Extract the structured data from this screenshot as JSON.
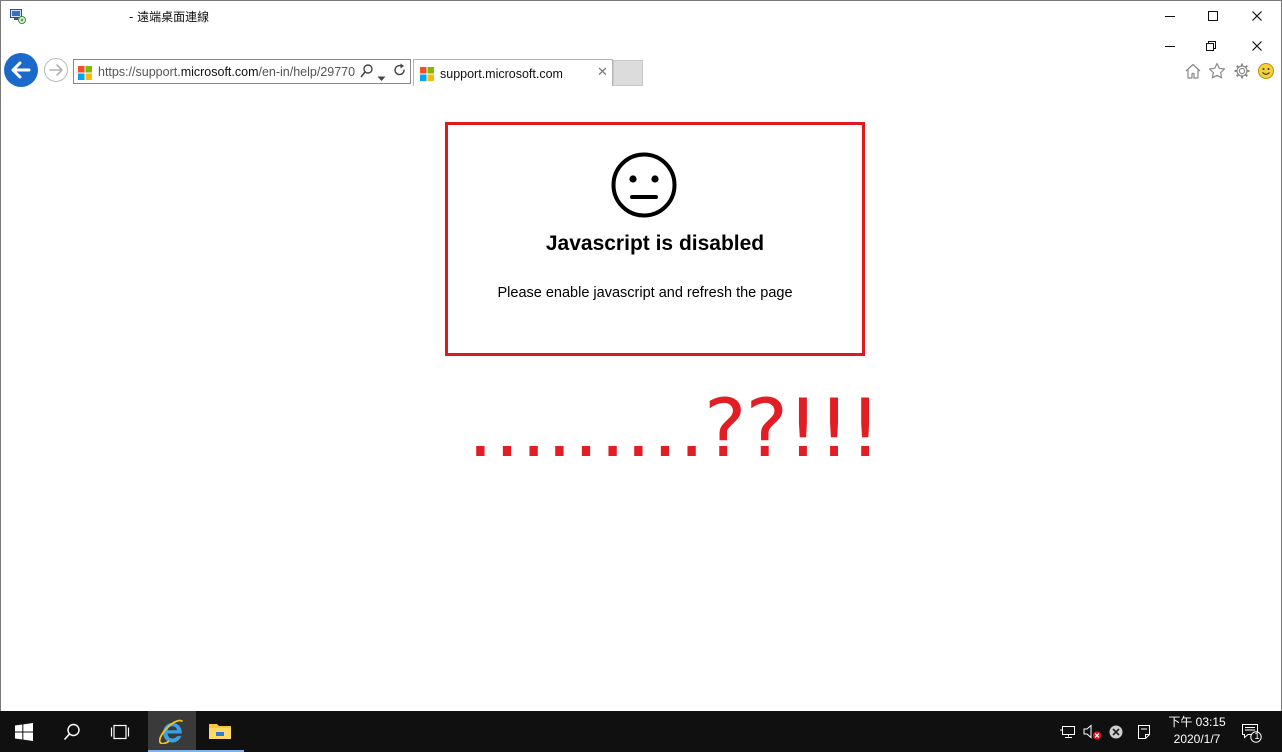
{
  "rdp_window": {
    "title": "- 遠端桌面連線"
  },
  "browser": {
    "address_url_prefix": "https://support.",
    "address_url_domain": "microsoft.com",
    "address_url_path": "/en-in/help/29770",
    "tab": {
      "title": "support.microsoft.com",
      "close_glyph": "✕"
    }
  },
  "page": {
    "heading": "Javascript is disabled",
    "message": "Please enable javascript and refresh the page",
    "annotation": "………??!!!"
  },
  "taskbar": {
    "clock_time": "下午 03:15",
    "clock_date": "2020/1/7",
    "notification_count": "1"
  },
  "colors": {
    "accent_red": "#e31d24",
    "back_button_blue": "#1b6ac9",
    "taskbar": "#101010"
  },
  "icons": [
    "rdp-app-icon",
    "minimize-icon",
    "maximize-icon",
    "close-icon",
    "restore-icon",
    "back-arrow-icon",
    "forward-arrow-icon",
    "microsoft-logo-icon",
    "search-icon",
    "dropdown-icon",
    "refresh-icon",
    "home-icon",
    "favorites-star-icon",
    "settings-gear-icon",
    "smiley-feedback-icon",
    "neutral-face-icon",
    "windows-start-icon",
    "search-taskbar-icon",
    "task-view-icon",
    "internet-explorer-icon",
    "file-explorer-icon",
    "network-icon",
    "volume-muted-icon",
    "error-icon",
    "notes-icon",
    "action-center-icon"
  ]
}
